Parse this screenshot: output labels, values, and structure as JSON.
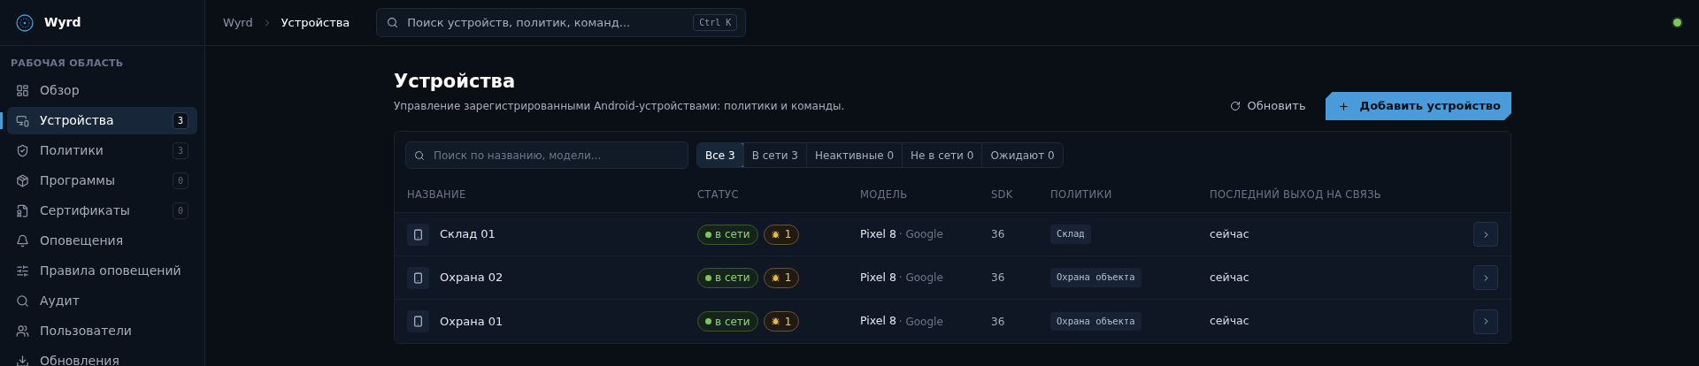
{
  "app": {
    "name": "Wyrd",
    "connected": true
  },
  "sidebar": {
    "section": "РАБОЧАЯ ОБЛАСТЬ",
    "items": [
      {
        "kind": "overview",
        "label": "Обзор",
        "selected": false
      },
      {
        "kind": "devices",
        "label": "Устройства",
        "badge": "3",
        "selected": true
      },
      {
        "kind": "policies",
        "label": "Политики",
        "badge": "3",
        "selected": false
      },
      {
        "kind": "apps",
        "label": "Программы",
        "badge": "0",
        "selected": false
      },
      {
        "kind": "certificates",
        "label": "Сертификаты",
        "badge": "0",
        "selected": false
      },
      {
        "kind": "alerts",
        "label": "Оповещения",
        "selected": false
      },
      {
        "kind": "rules",
        "label": "Правила оповещений",
        "selected": false
      },
      {
        "kind": "audit",
        "label": "Аудит",
        "selected": false
      },
      {
        "kind": "users",
        "label": "Пользователи",
        "selected": false
      },
      {
        "kind": "updates",
        "label": "Обновления",
        "selected": false
      }
    ]
  },
  "breadcrumbs": [
    "Wyrd",
    "Устройства"
  ],
  "global_search": {
    "placeholder": "Поиск устройств, политик, команд...",
    "shortcut": "Ctrl K"
  },
  "page": {
    "title": "Устройства",
    "subtitle": "Управление зарегистрированными Android-устройствами: политики и команды.",
    "refresh_button": "Обновить",
    "add_button": "Добавить устройство"
  },
  "table": {
    "search": {
      "placeholder": "Поиск по названию, модели..."
    },
    "filters": [
      {
        "label": "Все",
        "count": "3",
        "selected": true
      },
      {
        "label": "В сети",
        "count": "3",
        "selected": false
      },
      {
        "label": "Неактивные",
        "count": "0",
        "selected": false
      },
      {
        "label": "Не в сети",
        "count": "0",
        "selected": false
      },
      {
        "label": "Ожидают",
        "count": "0",
        "selected": false
      }
    ],
    "columns": [
      "НАЗВАНИЕ",
      "СТАТУС",
      "МОДЕЛЬ",
      "SDK",
      "ПОЛИТИКИ",
      "ПОСЛЕДНИЙ ВЫХОД НА СВЯЗЬ"
    ],
    "rows": [
      {
        "name": "Склад 01",
        "status": {
          "kind": "online",
          "label": "в сети"
        },
        "warnings": "1",
        "model": "Pixel 8",
        "vendor": "· Google",
        "sdk": "36",
        "policy": "Склад",
        "last_seen": "сейчас"
      },
      {
        "name": "Охрана 02",
        "status": {
          "kind": "online",
          "label": "в сети"
        },
        "warnings": "1",
        "model": "Pixel 8",
        "vendor": "· Google",
        "sdk": "36",
        "policy": "Охрана объекта",
        "last_seen": "сейчас"
      },
      {
        "name": "Охрана 01",
        "status": {
          "kind": "online",
          "label": "в сети"
        },
        "warnings": "1",
        "model": "Pixel 8",
        "vendor": "· Google",
        "sdk": "36",
        "policy": "Охрана объекта",
        "last_seen": "сейчас"
      }
    ]
  }
}
